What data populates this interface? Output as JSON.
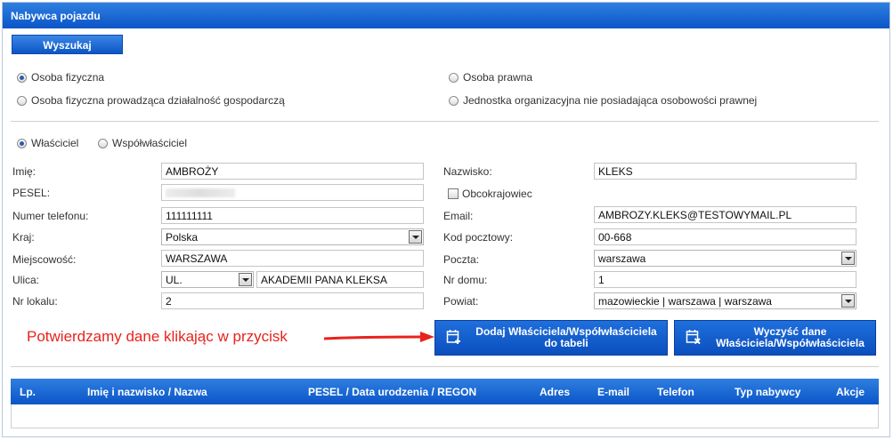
{
  "header": {
    "title": "Nabywca pojazdu"
  },
  "search_button": "Wyszukaj",
  "buyer_types": [
    {
      "label": "Osoba fizyczna",
      "checked": true
    },
    {
      "label": "Osoba prawna",
      "checked": false
    },
    {
      "label": "Osoba fizyczna prowadząca działalność gospodarczą",
      "checked": false
    },
    {
      "label": "Jednostka organizacyjna nie posiadająca osobowości prawnej",
      "checked": false
    }
  ],
  "owner_types": [
    {
      "label": "Właściciel",
      "checked": true
    },
    {
      "label": "Współwłaściciel",
      "checked": false
    }
  ],
  "form": {
    "first_name": {
      "label": "Imię:",
      "value": "AMBROŻY"
    },
    "pesel": {
      "label": "PESEL:",
      "value": ""
    },
    "phone": {
      "label": "Numer telefonu:",
      "value": "111111111"
    },
    "country": {
      "label": "Kraj:",
      "value": "Polska"
    },
    "city": {
      "label": "Miejscowość:",
      "value": "WARSZAWA"
    },
    "street": {
      "label": "Ulica:",
      "prefix": "UL.",
      "value": "AKADEMII PANA KLEKSA"
    },
    "apartment": {
      "label": "Nr lokalu:",
      "value": "2"
    },
    "last_name": {
      "label": "Nazwisko:",
      "value": "KLEKS"
    },
    "foreigner": {
      "label": "Obcokrajowiec",
      "checked": false
    },
    "email": {
      "label": "Email:",
      "value": "AMBROZY.KLEKS@TESTOWYMAIL.PL"
    },
    "postal_code": {
      "label": "Kod pocztowy:",
      "value": "00-668"
    },
    "post_office": {
      "label": "Poczta:",
      "value": "warszawa"
    },
    "house_number": {
      "label": "Nr domu:",
      "value": "1"
    },
    "county": {
      "label": "Powiat:",
      "value": "mazowieckie | warszawa | warszawa"
    }
  },
  "annotation": "Potwierdzamy dane klikając w przycisk",
  "buttons": {
    "add_line1": "Dodaj Właściciela/Współwłaściciela",
    "add_line2": "do tabeli",
    "clear_line1": "Wyczyść dane",
    "clear_line2": "Właściciela/Współwłaściciela"
  },
  "table": {
    "columns": [
      "Lp.",
      "Imię i nazwisko / Nazwa",
      "PESEL / Data urodzenia / REGON",
      "Adres",
      "E-mail",
      "Telefon",
      "Typ nabywcy",
      "Akcje"
    ],
    "rows": []
  },
  "colors": {
    "header_blue": "#0a55c8",
    "annotation_red": "#e8231c"
  }
}
